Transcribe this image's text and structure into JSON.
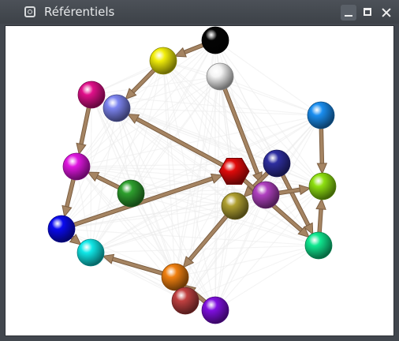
{
  "window": {
    "title": "Référentiels",
    "icons": {
      "app": "app-window-icon",
      "minimize": "minimize-icon",
      "maximize": "maximize-icon",
      "close": "close-icon"
    }
  },
  "graph": {
    "nodes": [
      {
        "id": "black",
        "color": "#050505",
        "shape": "sphere"
      },
      {
        "id": "yellow",
        "color": "#f2ee0a",
        "shape": "sphere"
      },
      {
        "id": "white",
        "color": "#f4f4f4",
        "shape": "sphere"
      },
      {
        "id": "magenta",
        "color": "#e0108a",
        "shape": "sphere"
      },
      {
        "id": "periwinkle",
        "color": "#7c84f0",
        "shape": "sphere"
      },
      {
        "id": "sky-blue",
        "color": "#1a8ef0",
        "shape": "sphere"
      },
      {
        "id": "violet",
        "color": "#e016e0",
        "shape": "sphere"
      },
      {
        "id": "red",
        "color": "#e00a0a",
        "shape": "hexagon"
      },
      {
        "id": "navy",
        "color": "#2e2ea0",
        "shape": "sphere"
      },
      {
        "id": "green",
        "color": "#2ea02e",
        "shape": "sphere"
      },
      {
        "id": "purple",
        "color": "#b040c0",
        "shape": "sphere"
      },
      {
        "id": "lime",
        "color": "#8ee010",
        "shape": "sphere"
      },
      {
        "id": "olive",
        "color": "#b0a030",
        "shape": "sphere"
      },
      {
        "id": "blue",
        "color": "#0a0af0",
        "shape": "sphere"
      },
      {
        "id": "spring-green",
        "color": "#10e890",
        "shape": "sphere"
      },
      {
        "id": "cyan",
        "color": "#10e8e8",
        "shape": "sphere"
      },
      {
        "id": "orange",
        "color": "#f08010",
        "shape": "sphere"
      },
      {
        "id": "brick",
        "color": "#c04040",
        "shape": "sphere"
      },
      {
        "id": "deep-violet",
        "color": "#8010e0",
        "shape": "sphere"
      }
    ],
    "edges": [
      [
        "black",
        "yellow"
      ],
      [
        "yellow",
        "periwinkle"
      ],
      [
        "magenta",
        "violet"
      ],
      [
        "violet",
        "blue"
      ],
      [
        "green",
        "violet"
      ],
      [
        "red",
        "periwinkle"
      ],
      [
        "blue",
        "red"
      ],
      [
        "blue",
        "cyan"
      ],
      [
        "white",
        "purple"
      ],
      [
        "navy",
        "olive"
      ],
      [
        "navy",
        "spring-green"
      ],
      [
        "red",
        "spring-green"
      ],
      [
        "sky-blue",
        "lime"
      ],
      [
        "spring-green",
        "lime"
      ],
      [
        "purple",
        "lime"
      ],
      [
        "olive",
        "orange"
      ],
      [
        "orange",
        "cyan"
      ],
      [
        "deep-violet",
        "orange"
      ]
    ],
    "colors": {
      "edge": "#a58462",
      "edge_dark": "#7d5f42",
      "background_edges": "#ececec"
    }
  }
}
